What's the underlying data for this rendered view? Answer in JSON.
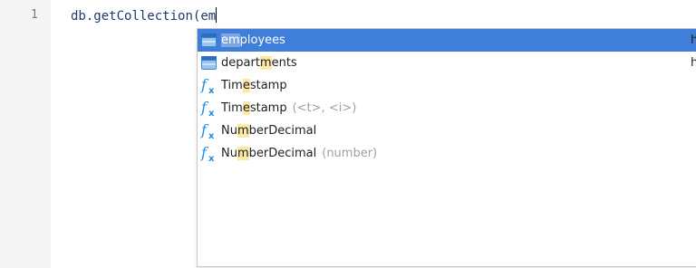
{
  "editor": {
    "line_number": "1",
    "code": {
      "object": "db",
      "dot": ".",
      "method": "getCollection",
      "paren": "(",
      "typed": "em"
    }
  },
  "suggestions": {
    "items": [
      {
        "icon": "collection-icon",
        "pre": "",
        "match": "em",
        "post": "ployees",
        "detail": "",
        "hint": "h",
        "selected": true
      },
      {
        "icon": "collection-icon",
        "pre": "depart",
        "match": "m",
        "post": "ents",
        "detail": "",
        "hint": "h",
        "selected": false
      },
      {
        "icon": "function-icon",
        "pre": "Tim",
        "match": "e",
        "post": "stamp",
        "detail": "",
        "hint": "",
        "selected": false
      },
      {
        "icon": "function-icon",
        "pre": "Tim",
        "match": "e",
        "post": "stamp",
        "detail": "(<t>, <i>)",
        "hint": "",
        "selected": false
      },
      {
        "icon": "function-icon",
        "pre": "Nu",
        "match": "m",
        "post": "berDecimal",
        "detail": "",
        "hint": "",
        "selected": false
      },
      {
        "icon": "function-icon",
        "pre": "Nu",
        "match": "m",
        "post": "berDecimal",
        "detail": "(number)",
        "hint": "",
        "selected": false
      }
    ]
  },
  "colors": {
    "selected_bg": "#3f7fd9",
    "match_highlight": "#fce9a6",
    "function_icon": "#1f8be0",
    "collection_icon": "#3a86d6"
  }
}
